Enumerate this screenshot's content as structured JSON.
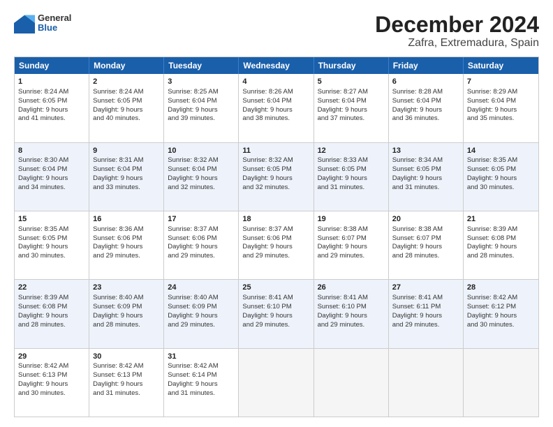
{
  "header": {
    "logo": {
      "general": "General",
      "blue": "Blue"
    },
    "title": "December 2024",
    "subtitle": "Zafra, Extremadura, Spain"
  },
  "days": [
    "Sunday",
    "Monday",
    "Tuesday",
    "Wednesday",
    "Thursday",
    "Friday",
    "Saturday"
  ],
  "weeks": [
    [
      {
        "day": "1",
        "sunrise": "Sunrise: 8:24 AM",
        "sunset": "Sunset: 6:05 PM",
        "daylight": "Daylight: 9 hours and 41 minutes."
      },
      {
        "day": "2",
        "sunrise": "Sunrise: 8:24 AM",
        "sunset": "Sunset: 6:05 PM",
        "daylight": "Daylight: 9 hours and 40 minutes."
      },
      {
        "day": "3",
        "sunrise": "Sunrise: 8:25 AM",
        "sunset": "Sunset: 6:04 PM",
        "daylight": "Daylight: 9 hours and 39 minutes."
      },
      {
        "day": "4",
        "sunrise": "Sunrise: 8:26 AM",
        "sunset": "Sunset: 6:04 PM",
        "daylight": "Daylight: 9 hours and 38 minutes."
      },
      {
        "day": "5",
        "sunrise": "Sunrise: 8:27 AM",
        "sunset": "Sunset: 6:04 PM",
        "daylight": "Daylight: 9 hours and 37 minutes."
      },
      {
        "day": "6",
        "sunrise": "Sunrise: 8:28 AM",
        "sunset": "Sunset: 6:04 PM",
        "daylight": "Daylight: 9 hours and 36 minutes."
      },
      {
        "day": "7",
        "sunrise": "Sunrise: 8:29 AM",
        "sunset": "Sunset: 6:04 PM",
        "daylight": "Daylight: 9 hours and 35 minutes."
      }
    ],
    [
      {
        "day": "8",
        "sunrise": "Sunrise: 8:30 AM",
        "sunset": "Sunset: 6:04 PM",
        "daylight": "Daylight: 9 hours and 34 minutes."
      },
      {
        "day": "9",
        "sunrise": "Sunrise: 8:31 AM",
        "sunset": "Sunset: 6:04 PM",
        "daylight": "Daylight: 9 hours and 33 minutes."
      },
      {
        "day": "10",
        "sunrise": "Sunrise: 8:32 AM",
        "sunset": "Sunset: 6:04 PM",
        "daylight": "Daylight: 9 hours and 32 minutes."
      },
      {
        "day": "11",
        "sunrise": "Sunrise: 8:32 AM",
        "sunset": "Sunset: 6:05 PM",
        "daylight": "Daylight: 9 hours and 32 minutes."
      },
      {
        "day": "12",
        "sunrise": "Sunrise: 8:33 AM",
        "sunset": "Sunset: 6:05 PM",
        "daylight": "Daylight: 9 hours and 31 minutes."
      },
      {
        "day": "13",
        "sunrise": "Sunrise: 8:34 AM",
        "sunset": "Sunset: 6:05 PM",
        "daylight": "Daylight: 9 hours and 31 minutes."
      },
      {
        "day": "14",
        "sunrise": "Sunrise: 8:35 AM",
        "sunset": "Sunset: 6:05 PM",
        "daylight": "Daylight: 9 hours and 30 minutes."
      }
    ],
    [
      {
        "day": "15",
        "sunrise": "Sunrise: 8:35 AM",
        "sunset": "Sunset: 6:05 PM",
        "daylight": "Daylight: 9 hours and 30 minutes."
      },
      {
        "day": "16",
        "sunrise": "Sunrise: 8:36 AM",
        "sunset": "Sunset: 6:06 PM",
        "daylight": "Daylight: 9 hours and 29 minutes."
      },
      {
        "day": "17",
        "sunrise": "Sunrise: 8:37 AM",
        "sunset": "Sunset: 6:06 PM",
        "daylight": "Daylight: 9 hours and 29 minutes."
      },
      {
        "day": "18",
        "sunrise": "Sunrise: 8:37 AM",
        "sunset": "Sunset: 6:06 PM",
        "daylight": "Daylight: 9 hours and 29 minutes."
      },
      {
        "day": "19",
        "sunrise": "Sunrise: 8:38 AM",
        "sunset": "Sunset: 6:07 PM",
        "daylight": "Daylight: 9 hours and 29 minutes."
      },
      {
        "day": "20",
        "sunrise": "Sunrise: 8:38 AM",
        "sunset": "Sunset: 6:07 PM",
        "daylight": "Daylight: 9 hours and 28 minutes."
      },
      {
        "day": "21",
        "sunrise": "Sunrise: 8:39 AM",
        "sunset": "Sunset: 6:08 PM",
        "daylight": "Daylight: 9 hours and 28 minutes."
      }
    ],
    [
      {
        "day": "22",
        "sunrise": "Sunrise: 8:39 AM",
        "sunset": "Sunset: 6:08 PM",
        "daylight": "Daylight: 9 hours and 28 minutes."
      },
      {
        "day": "23",
        "sunrise": "Sunrise: 8:40 AM",
        "sunset": "Sunset: 6:09 PM",
        "daylight": "Daylight: 9 hours and 28 minutes."
      },
      {
        "day": "24",
        "sunrise": "Sunrise: 8:40 AM",
        "sunset": "Sunset: 6:09 PM",
        "daylight": "Daylight: 9 hours and 29 minutes."
      },
      {
        "day": "25",
        "sunrise": "Sunrise: 8:41 AM",
        "sunset": "Sunset: 6:10 PM",
        "daylight": "Daylight: 9 hours and 29 minutes."
      },
      {
        "day": "26",
        "sunrise": "Sunrise: 8:41 AM",
        "sunset": "Sunset: 6:10 PM",
        "daylight": "Daylight: 9 hours and 29 minutes."
      },
      {
        "day": "27",
        "sunrise": "Sunrise: 8:41 AM",
        "sunset": "Sunset: 6:11 PM",
        "daylight": "Daylight: 9 hours and 29 minutes."
      },
      {
        "day": "28",
        "sunrise": "Sunrise: 8:42 AM",
        "sunset": "Sunset: 6:12 PM",
        "daylight": "Daylight: 9 hours and 30 minutes."
      }
    ],
    [
      {
        "day": "29",
        "sunrise": "Sunrise: 8:42 AM",
        "sunset": "Sunset: 6:13 PM",
        "daylight": "Daylight: 9 hours and 30 minutes."
      },
      {
        "day": "30",
        "sunrise": "Sunrise: 8:42 AM",
        "sunset": "Sunset: 6:13 PM",
        "daylight": "Daylight: 9 hours and 31 minutes."
      },
      {
        "day": "31",
        "sunrise": "Sunrise: 8:42 AM",
        "sunset": "Sunset: 6:14 PM",
        "daylight": "Daylight: 9 hours and 31 minutes."
      },
      null,
      null,
      null,
      null
    ]
  ]
}
